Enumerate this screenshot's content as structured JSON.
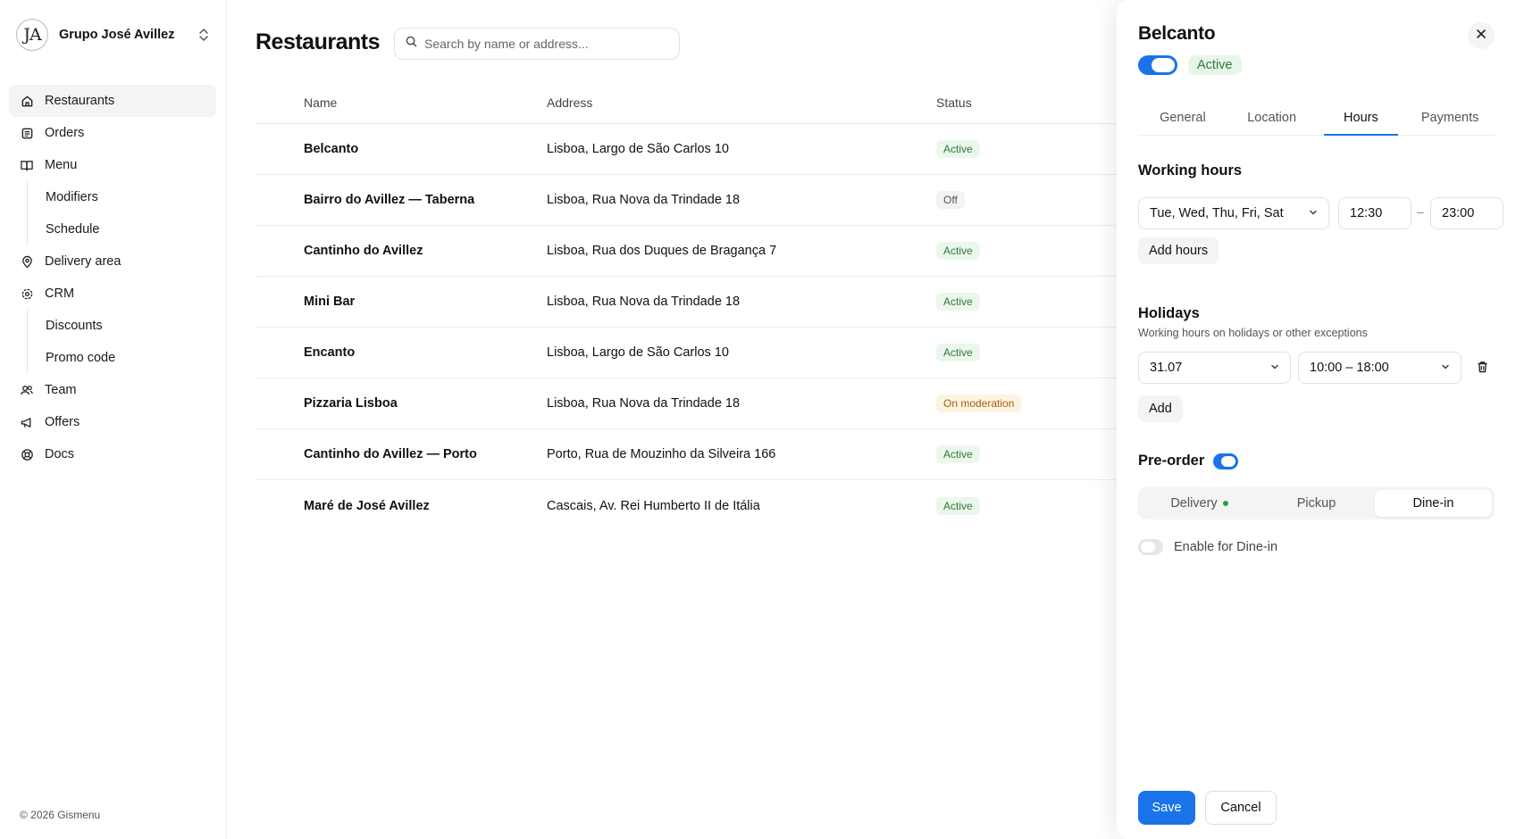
{
  "org": {
    "logo_text": "JA",
    "name": "Grupo José Avillez"
  },
  "nav": {
    "restaurants": "Restaurants",
    "orders": "Orders",
    "menu": "Menu",
    "modifiers": "Modifiers",
    "schedule": "Schedule",
    "delivery_area": "Delivery area",
    "crm": "CRM",
    "discounts": "Discounts",
    "promo_code": "Promo code",
    "team": "Team",
    "offers": "Offers",
    "docs": "Docs"
  },
  "footer": {
    "copyright": "© 2026 Gismenu"
  },
  "main": {
    "title": "Restaurants",
    "search_placeholder": "Search by name or address...",
    "columns": {
      "name": "Name",
      "address": "Address",
      "status": "Status"
    },
    "rows": [
      {
        "name": "Belcanto",
        "address": "Lisboa, Largo de São Carlos 10",
        "status": "Active"
      },
      {
        "name": "Bairro do Avillez — Taberna",
        "address": "Lisboa, Rua Nova da Trindade 18",
        "status": "Off"
      },
      {
        "name": "Cantinho do Avillez",
        "address": "Lisboa, Rua dos Duques de Bragança 7",
        "status": "Active"
      },
      {
        "name": "Mini Bar",
        "address": "Lisboa, Rua Nova da Trindade 18",
        "status": "Active"
      },
      {
        "name": "Encanto",
        "address": "Lisboa, Largo de São Carlos 10",
        "status": "Active"
      },
      {
        "name": "Pizzaria Lisboa",
        "address": "Lisboa, Rua Nova da Trindade 18",
        "status": "On moderation"
      },
      {
        "name": "Cantinho do Avillez — Porto",
        "address": "Porto, Rua de Mouzinho da Silveira 166",
        "status": "Active"
      },
      {
        "name": "Maré de José Avillez",
        "address": "Cascais, Av. Rei Humberto II de Itália",
        "status": "Active"
      }
    ]
  },
  "panel": {
    "title": "Belcanto",
    "status": "Active",
    "tabs": [
      "General",
      "Location",
      "Hours",
      "Payments"
    ],
    "active_tab": "Hours",
    "working_hours": {
      "title": "Working hours",
      "days": "Tue, Wed, Thu, Fri, Sat",
      "from": "12:30",
      "separator": "–",
      "to": "23:00",
      "add_label": "Add hours"
    },
    "holidays": {
      "title": "Holidays",
      "subtitle": "Working hours on holidays or other exceptions",
      "date": "31.07",
      "hours": "10:00 – 18:00",
      "add_label": "Add"
    },
    "preorder": {
      "title": "Pre-order",
      "enabled": true,
      "options": [
        "Delivery",
        "Pickup",
        "Dine-in"
      ],
      "selected": "Dine-in",
      "enable_label": "Enable for Dine-in",
      "enable_on": false
    },
    "save_label": "Save",
    "cancel_label": "Cancel"
  },
  "colors": {
    "accent": "#1a73e8",
    "active_badge_bg": "#ecf7ec",
    "moderation_badge_bg": "#fdf3e3",
    "green_dot": "#22a34a"
  }
}
